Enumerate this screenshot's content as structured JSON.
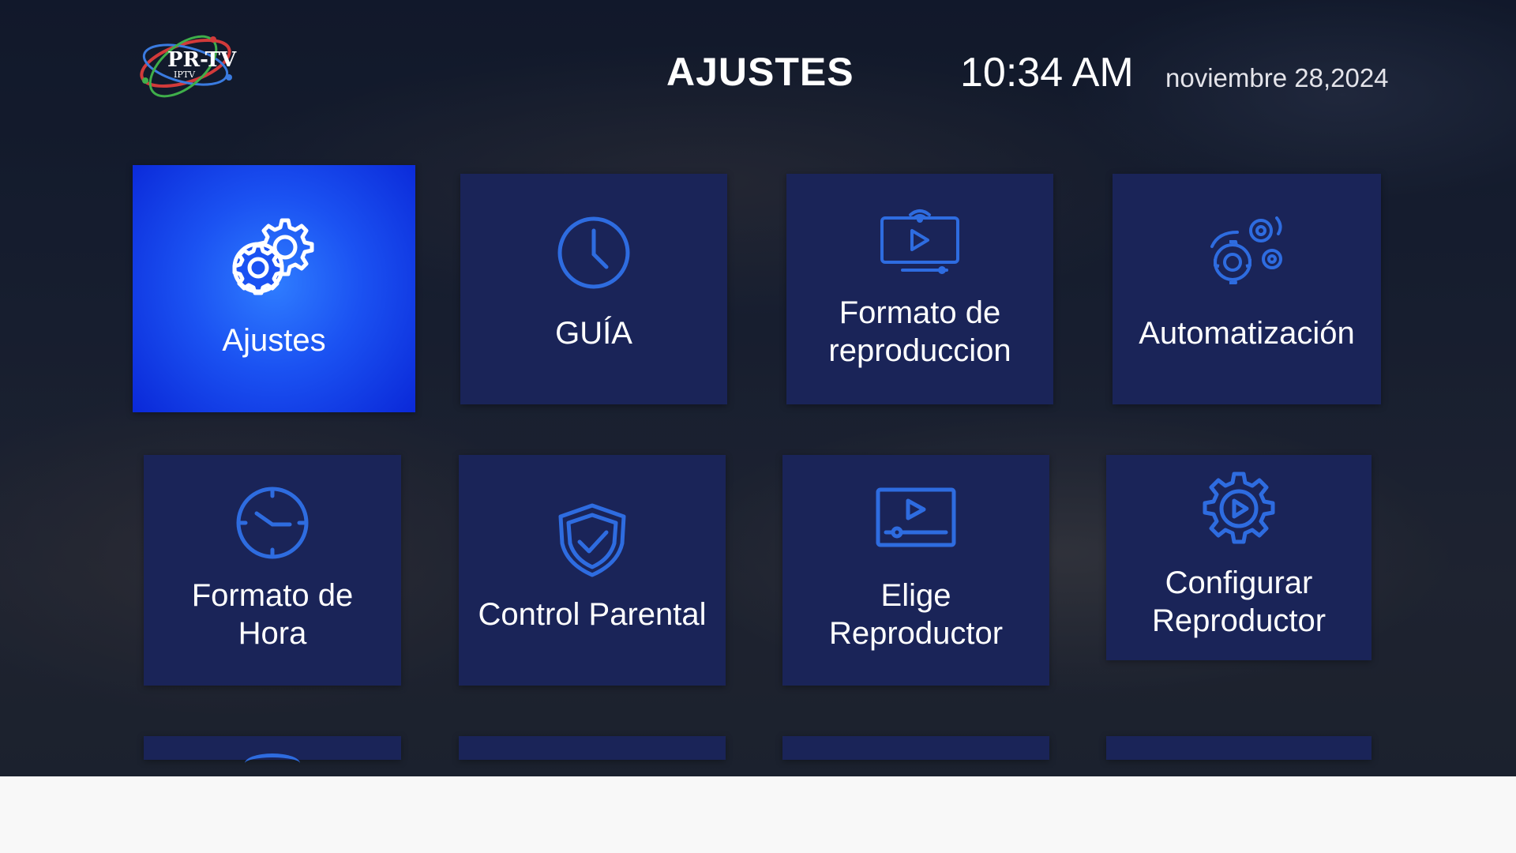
{
  "header": {
    "logo_text": "PR-TV",
    "logo_subtext": "IPTV",
    "title": "AJUSTES",
    "time": "10:34 AM",
    "date": "noviembre 28,2024"
  },
  "tiles": [
    {
      "label": "Ajustes",
      "icon": "gears-icon",
      "focused": true
    },
    {
      "label": "GUÍA",
      "icon": "clock-icon"
    },
    {
      "label_line1": "Formato de",
      "label_line2": "reproduccion",
      "icon": "tv-play-icon"
    },
    {
      "label": "Automatización",
      "icon": "automation-gears-icon"
    },
    {
      "label_line1": "Formato de",
      "label_line2": "Hora",
      "icon": "clock-icon"
    },
    {
      "label": "Control Parental",
      "icon": "shield-check-icon"
    },
    {
      "label_line1": "Elige",
      "label_line2": "Reproductor",
      "icon": "video-player-icon"
    },
    {
      "label_line1": "Configurar",
      "label_line2": "Reproductor",
      "icon": "gear-play-icon"
    }
  ],
  "colors": {
    "tile": "#1a2458",
    "focused_tile": "#1b52f2",
    "icon_blue": "#2e6ce0"
  }
}
